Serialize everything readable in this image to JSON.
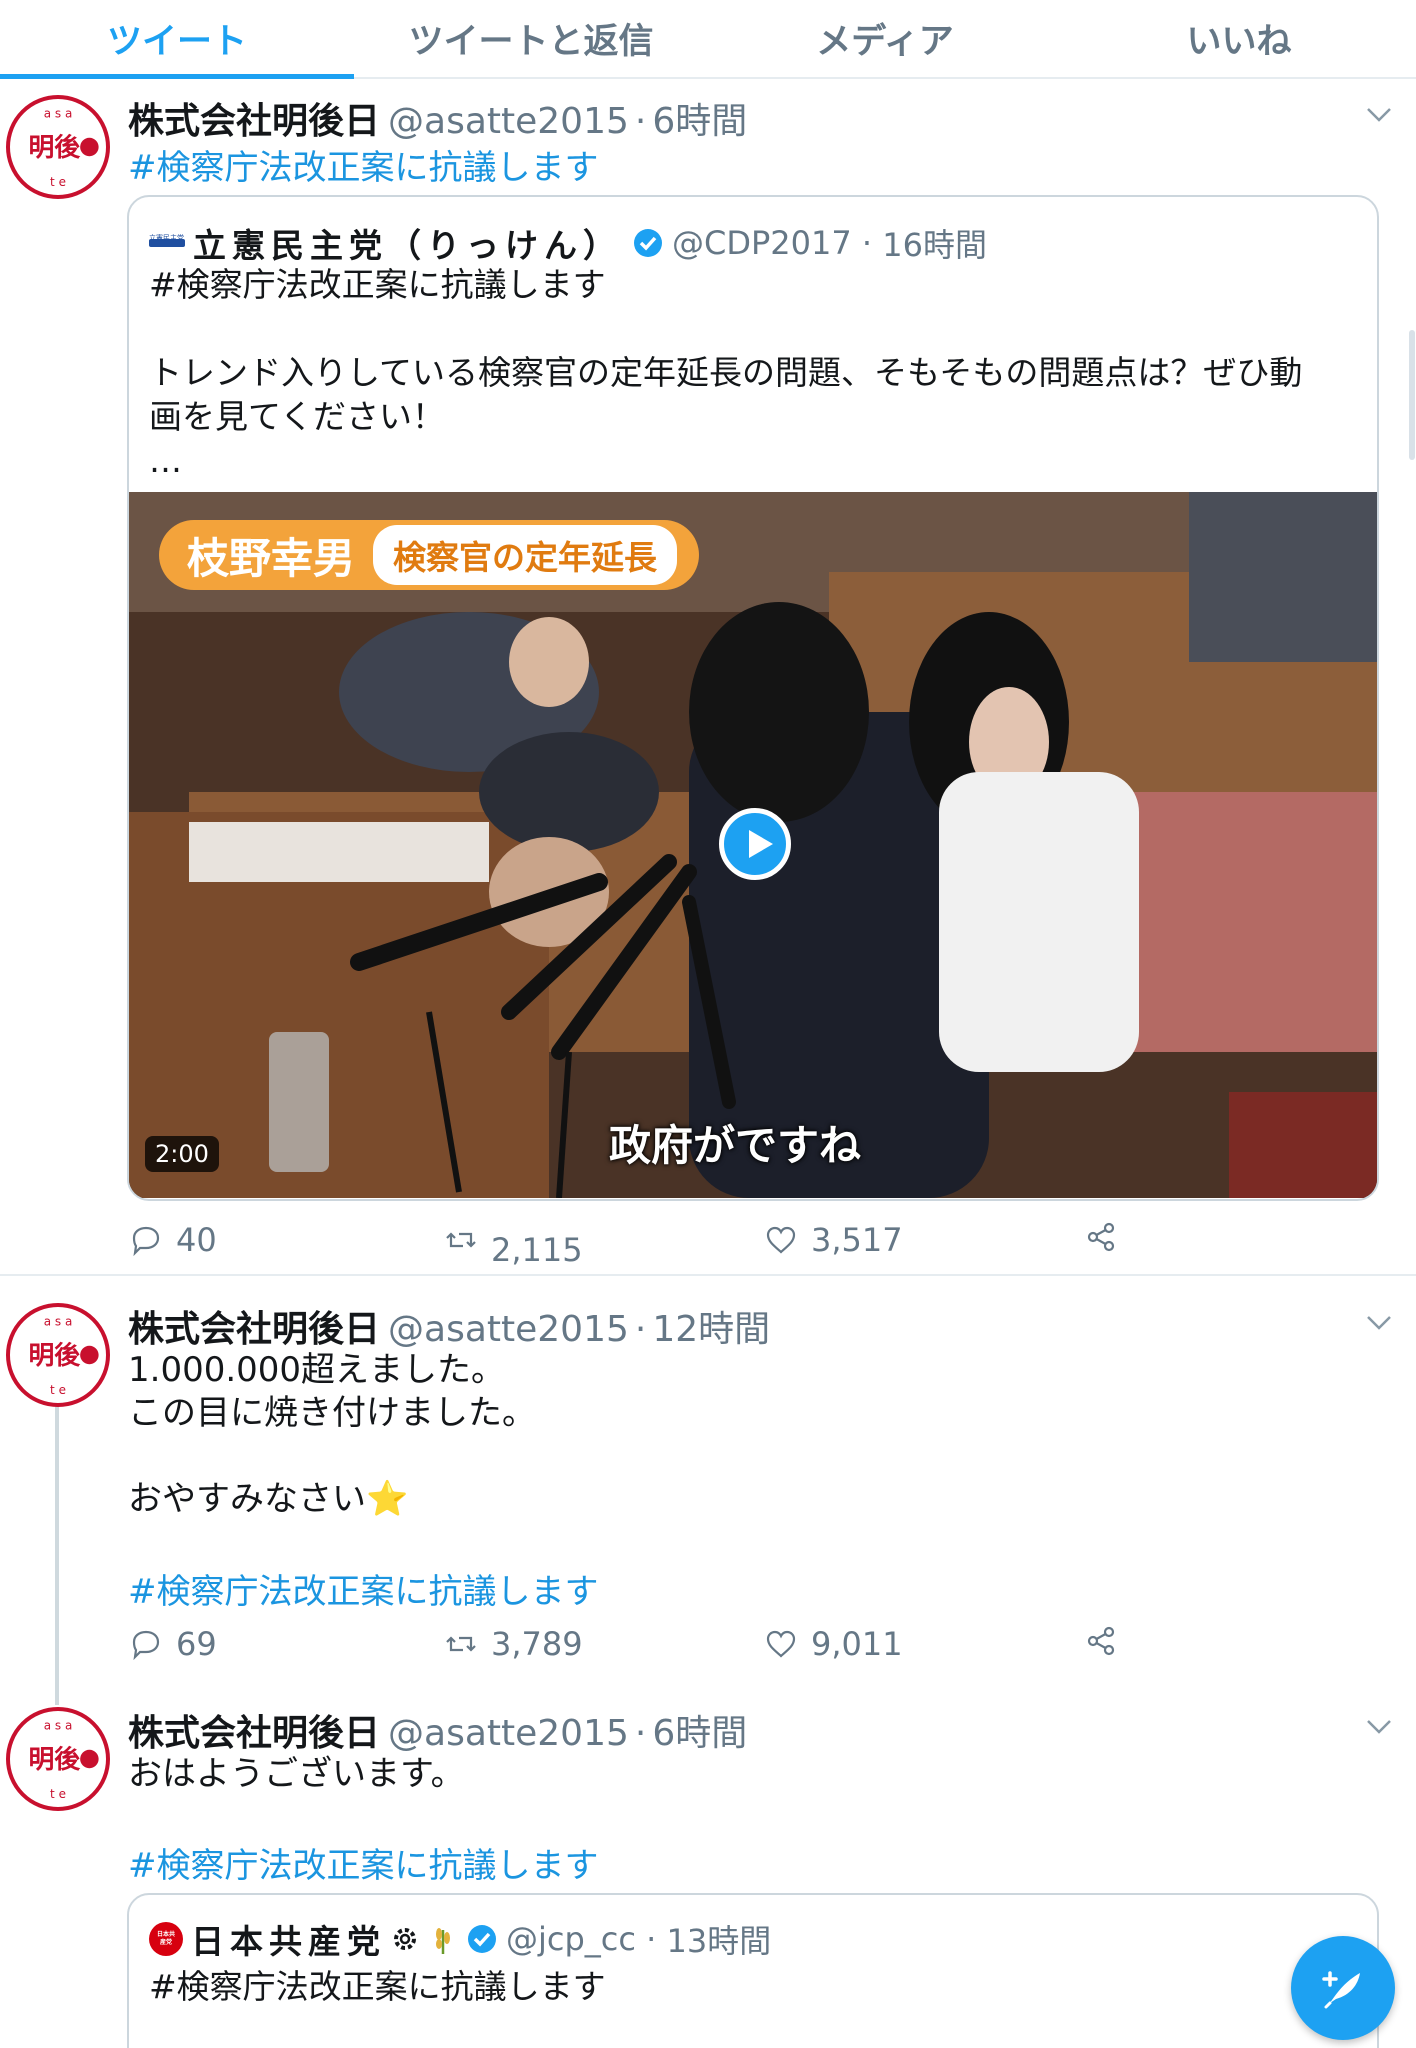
{
  "tabs": [
    {
      "label": "ツイート",
      "active": true
    },
    {
      "label": "ツイートと返信",
      "active": false
    },
    {
      "label": "メディア",
      "active": false
    },
    {
      "label": "いいね",
      "active": false
    }
  ],
  "avatar": {
    "glyph": "明後",
    "ring_letters": "a s a t t e"
  },
  "tweets": [
    {
      "name": "株式会社明後日",
      "handle": "@asatte2015",
      "time": "6時間",
      "hashtag": "#検察庁法改正案に抗議します",
      "quote": {
        "logo_text": "立憲民主党",
        "name": "立憲民主党（りっけん）",
        "handle": "@CDP2017",
        "time": "16時間",
        "text": "#検察庁法改正案に抗議します\n\nトレンド入りしている検察官の定年延長の問題、そもそもの問題点は？ぜひ動\n画を見てください！\n…",
        "video": {
          "tag_name": "枝野幸男",
          "tag_subject": "検察官の定年延長",
          "caption": "政府がですね",
          "duration": "2:00"
        }
      },
      "stats": {
        "replies": "40",
        "retweets": "2,115",
        "likes": "3,517"
      }
    },
    {
      "name": "株式会社明後日",
      "handle": "@asatte2015",
      "time": "12時間",
      "text": "1.000.000超えました。\nこの目に焼き付けました。\n\nおやすみなさい⭐",
      "hashtag": "#検察庁法改正案に抗議します",
      "stats": {
        "replies": "69",
        "retweets": "3,789",
        "likes": "9,011"
      }
    },
    {
      "name": "株式会社明後日",
      "handle": "@asatte2015",
      "time": "6時間",
      "text": "おはようございます。",
      "hashtag": "#検察庁法改正案に抗議します",
      "quote": {
        "logo_text": "日本共産党",
        "name": "日本共産党",
        "handle": "@jcp_cc",
        "time": "13時間",
        "text": "#検察庁法改正案に抗議します"
      }
    }
  ],
  "colors": {
    "accent": "#1da1f2",
    "hashtag": "#1b95e0",
    "muted": "#657786",
    "avatar_red": "#c8102e"
  }
}
